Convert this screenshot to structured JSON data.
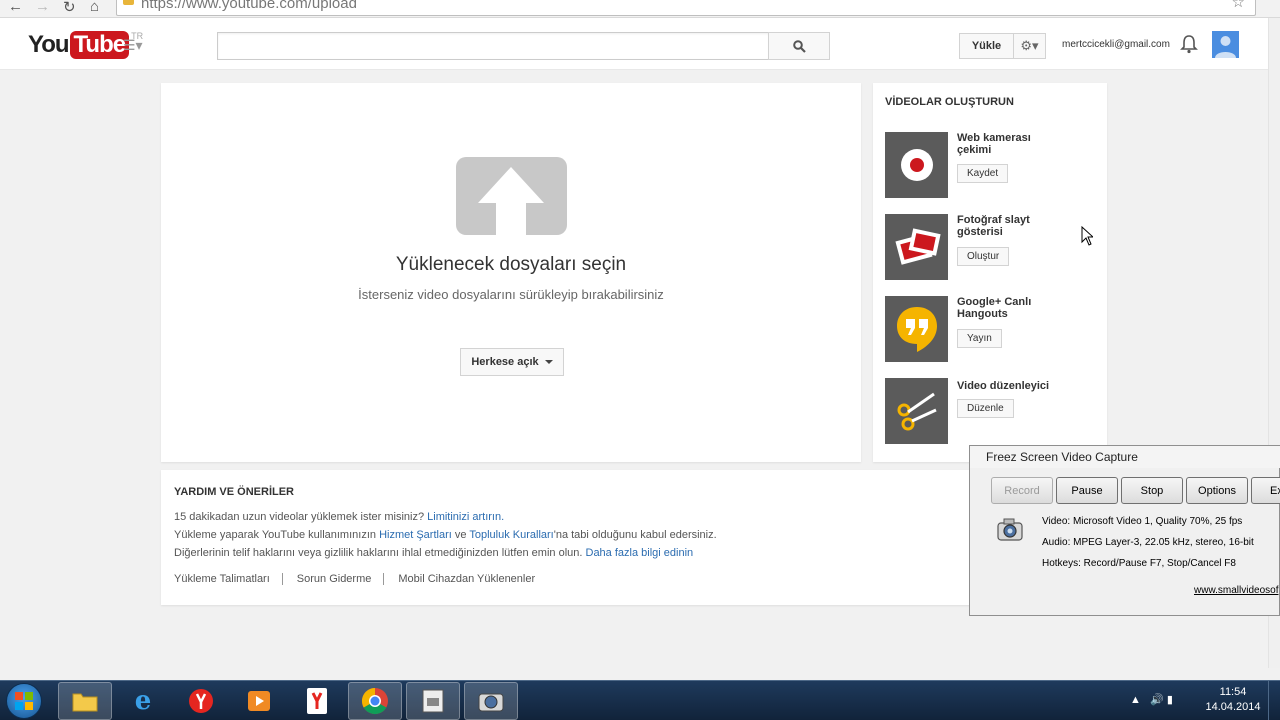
{
  "browser": {
    "url": "https://www.youtube.com/upload"
  },
  "header": {
    "logo_you": "You",
    "logo_tube": "Tube",
    "logo_region": "TR",
    "search_placeholder": "",
    "upload_label": "Yükle",
    "account_email": "mertccicekli@gmail.com"
  },
  "upload": {
    "title": "Yüklenecek dosyaları seçin",
    "subtitle": "İsterseniz video dosyalarını sürükleyip bırakabilirsiniz",
    "privacy_label": "Herkese açık"
  },
  "create": {
    "title": "VİDEOLAR OLUŞTURUN",
    "items": [
      {
        "label": "Web kamerası çekimi",
        "button": "Kaydet"
      },
      {
        "label": "Fotoğraf slayt gösterisi",
        "button": "Oluştur"
      },
      {
        "label": "Google+ Canlı Hangouts",
        "button": "Yayın"
      },
      {
        "label": "Video düzenleyici",
        "button": "Düzenle"
      }
    ]
  },
  "help": {
    "title": "YARDIM VE ÖNERİLER",
    "line1_text": "15 dakikadan uzun videolar yüklemek ister misiniz?",
    "line1_link": "Limitinizi artırın.",
    "line2_a": "Yükleme yaparak YouTube kullanımınızın",
    "line2_link1": "Hizmet Şartları",
    "line2_b": "ve",
    "line2_link2": "Topluluk Kuralları",
    "line2_c": "'na tabi olduğunu kabul edersiniz.",
    "line3_text": "Diğerlerinin telif haklarını veya gizlilik haklarını ihlal etmediğinizden lütfen emin olun.",
    "line3_link": "Daha fazla bilgi edinin",
    "footer_links": [
      "Yükleme Talimatları",
      "Sorun Giderme",
      "Mobil Cihazdan Yüklenenler"
    ]
  },
  "capture": {
    "title": "Freez Screen Video Capture",
    "buttons": [
      "Record",
      "Pause",
      "Stop",
      "Options",
      "Ex"
    ],
    "video_info": "Video: Microsoft Video 1, Quality 70%, 25 fps",
    "audio_info": "Audio: MPEG Layer-3, 22.05 kHz, stereo, 16-bit",
    "hotkeys_info": "Hotkeys: Record/Pause F7, Stop/Cancel F8",
    "link": "www.smallvideosof"
  },
  "taskbar": {
    "time": "11:54",
    "date": "14.04.2014"
  },
  "colors": {
    "brand_red": "#cc181e",
    "link_blue": "#2b6cb0",
    "taskbar": "#1e3a5c"
  }
}
